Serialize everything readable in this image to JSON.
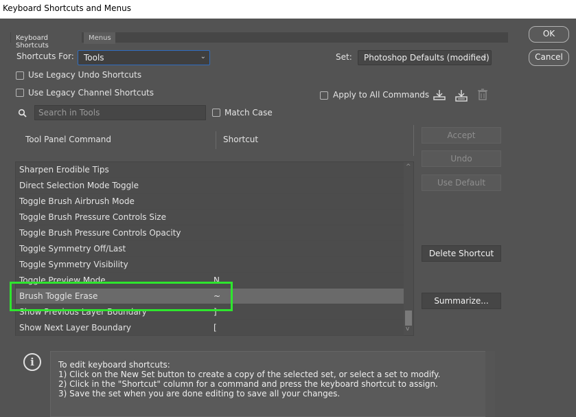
{
  "window": {
    "title": "Keyboard Shortcuts and Menus"
  },
  "tabs": [
    {
      "label": "Keyboard Shortcuts"
    },
    {
      "label": "Menus"
    }
  ],
  "shortcuts_for": {
    "label": "Shortcuts For:",
    "value": "Tools"
  },
  "set": {
    "label": "Set:",
    "value": "Photoshop Defaults (modified)"
  },
  "options": {
    "legacy_undo": "Use Legacy Undo Shortcuts",
    "legacy_channel": "Use Legacy Channel Shortcuts",
    "apply_all": "Apply to All Commands",
    "match_case": "Match Case"
  },
  "search": {
    "placeholder": "Search in Tools"
  },
  "table": {
    "col_command": "Tool Panel Command",
    "col_shortcut": "Shortcut",
    "rows": [
      {
        "command": "Sharpen Erodible Tips",
        "shortcut": ""
      },
      {
        "command": "Direct Selection Mode Toggle",
        "shortcut": ""
      },
      {
        "command": "Toggle Brush Airbrush Mode",
        "shortcut": ""
      },
      {
        "command": "Toggle Brush Pressure Controls Size",
        "shortcut": ""
      },
      {
        "command": "Toggle Brush Pressure Controls Opacity",
        "shortcut": ""
      },
      {
        "command": "Toggle Symmetry Off/Last",
        "shortcut": ""
      },
      {
        "command": "Toggle Symmetry Visibility",
        "shortcut": ""
      },
      {
        "command": "Toggle Preview Mode",
        "shortcut": "N"
      },
      {
        "command": "Brush Toggle Erase",
        "shortcut": "~"
      },
      {
        "command": "Show Previous Layer Boundary",
        "shortcut": "]"
      },
      {
        "command": "Show Next Layer Boundary",
        "shortcut": "["
      }
    ]
  },
  "buttons": {
    "ok": "OK",
    "cancel": "Cancel",
    "accept": "Accept",
    "undo": "Undo",
    "use_default": "Use Default",
    "delete_shortcut": "Delete Shortcut",
    "summarize": "Summarize..."
  },
  "info": {
    "lines": [
      "To edit keyboard shortcuts:",
      "1) Click on the New Set button to create a copy of the selected set, or select a set to modify.",
      "2) Click in the \"Shortcut\" column for a command and press the keyboard shortcut to assign.",
      "3) Save the set when you are done editing to save all your changes."
    ]
  },
  "colors": {
    "highlight": "#2ee62e",
    "panel_bg": "#535353",
    "select_focus": "#2f6dc0"
  }
}
